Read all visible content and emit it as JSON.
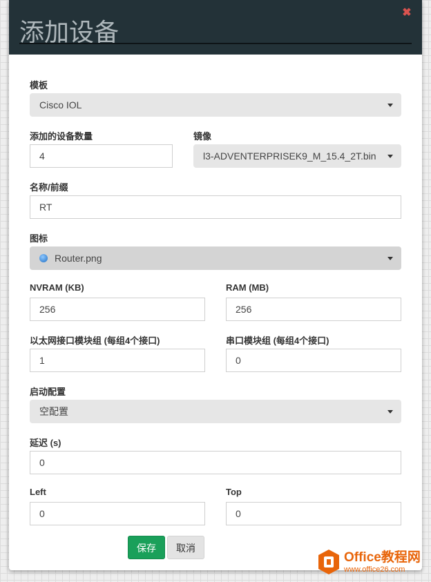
{
  "dialog": {
    "title": "添加设备",
    "close_symbol": "✖"
  },
  "form": {
    "template": {
      "label": "模板",
      "value": "Cisco IOL"
    },
    "count": {
      "label": "添加的设备数量",
      "value": "4"
    },
    "image": {
      "label": "镜像",
      "value": "l3-ADVENTERPRISEK9_M_15.4_2T.bin"
    },
    "name": {
      "label": "名称/前缀",
      "value": "RT"
    },
    "icon": {
      "label": "图标",
      "value": "Router.png",
      "icon_name": "router-icon"
    },
    "nvram": {
      "label": "NVRAM (KB)",
      "value": "256"
    },
    "ram": {
      "label": "RAM (MB)",
      "value": "256"
    },
    "ethernet": {
      "label": "以太网接口模块组 (每组4个接口)",
      "value": "1"
    },
    "serial": {
      "label": "串口模块组 (每组4个接口)",
      "value": "0"
    },
    "startup": {
      "label": "启动配置",
      "value": "空配置"
    },
    "delay": {
      "label": "延迟 (s)",
      "value": "0"
    },
    "left": {
      "label": "Left",
      "value": "0"
    },
    "top": {
      "label": "Top",
      "value": "0"
    }
  },
  "buttons": {
    "save": "保存",
    "cancel": "取消"
  },
  "watermark": {
    "title": "Office教程网",
    "url": "www.office26.com"
  },
  "colors": {
    "header_bg": "#233238",
    "save_button": "#1aa05a",
    "close_icon": "#d9534f",
    "watermark": "#e8650a"
  }
}
